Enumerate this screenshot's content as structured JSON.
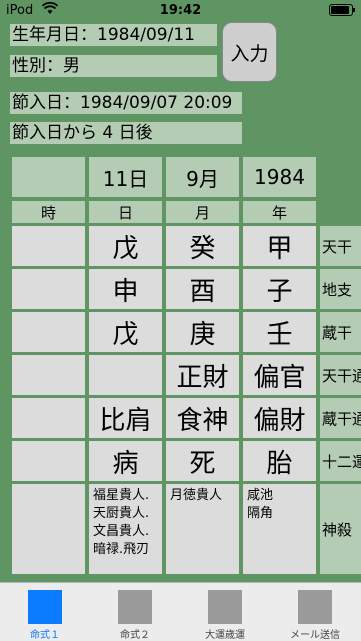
{
  "status": {
    "carrier": "iPod",
    "time": "19:42"
  },
  "info": {
    "birth": "生年月日：1984/09/11",
    "gender": "性別：男",
    "setsu": "節入日：1984/09/07 20:09",
    "after": "節入日から 4 日後",
    "input_label": "入力"
  },
  "grid": {
    "top": [
      "",
      "11日",
      "9月",
      "1984"
    ],
    "labels": [
      "時",
      "日",
      "月",
      "年"
    ],
    "rows": [
      {
        "cells": [
          "",
          "戊",
          "癸",
          "甲"
        ],
        "side": "天干"
      },
      {
        "cells": [
          "",
          "申",
          "酉",
          "子"
        ],
        "side": "地支"
      },
      {
        "cells": [
          "",
          "戊",
          "庚",
          "壬"
        ],
        "side": "蔵干"
      },
      {
        "cells": [
          "",
          "",
          "正財",
          "偏官"
        ],
        "side": "天干通"
      },
      {
        "cells": [
          "",
          "比肩",
          "食神",
          "偏財"
        ],
        "side": "蔵干通"
      },
      {
        "cells": [
          "",
          "病",
          "死",
          "胎"
        ],
        "side": "十二運"
      }
    ],
    "shin": {
      "cells": [
        "",
        "福星貴人.\n天厨貴人.\n文昌貴人.\n暗禄.飛刃",
        "月徳貴人",
        "咸池\n隔角"
      ],
      "side": "神殺"
    }
  },
  "tabs": [
    {
      "label": "命式１",
      "active": true
    },
    {
      "label": "命式２",
      "active": false
    },
    {
      "label": "大運歳運",
      "active": false
    },
    {
      "label": "メール送信",
      "active": false
    }
  ]
}
